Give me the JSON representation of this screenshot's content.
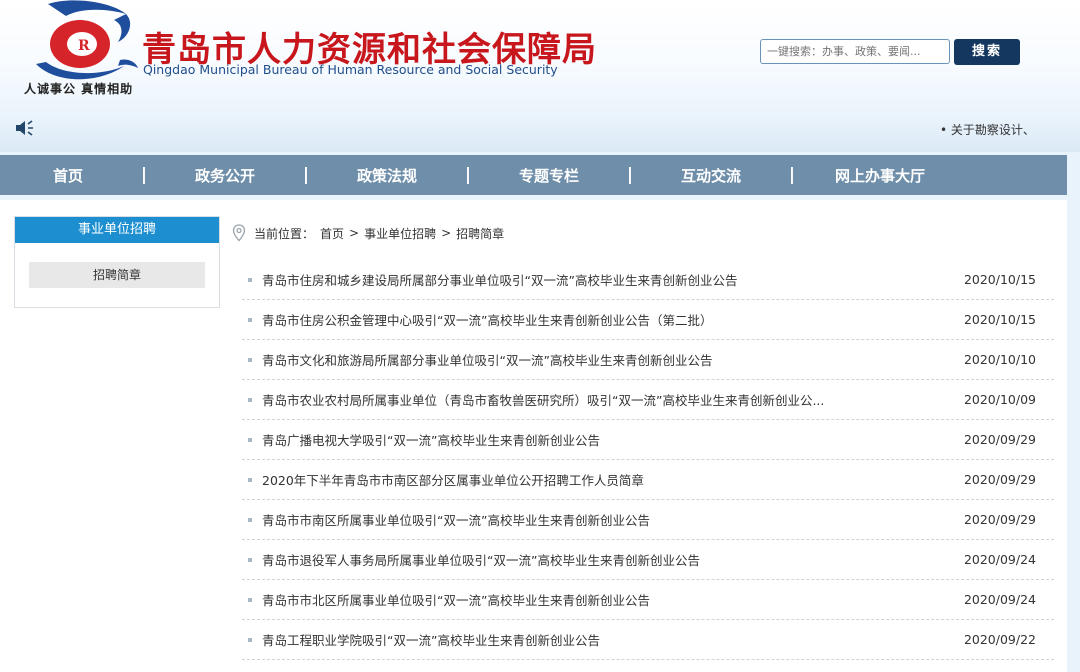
{
  "header": {
    "title_cn": "青岛市人力资源和社会保障局",
    "title_en": "Qingdao Municipal Bureau of Human Resource and Social Security",
    "slogan": "人诚事公  真情相助",
    "logo_icon": "bureau-logo-icon",
    "search": {
      "placeholder": "一键搜索：办事、政策、要闻...",
      "button_label": "搜索"
    }
  },
  "notice": {
    "icon": "speaker-icon",
    "text": "• 关于勘察设计、"
  },
  "nav": {
    "items": [
      {
        "label": "首页"
      },
      {
        "label": "政务公开"
      },
      {
        "label": "政策法规"
      },
      {
        "label": "专题专栏"
      },
      {
        "label": "互动交流"
      },
      {
        "label": "网上办事大厅"
      }
    ]
  },
  "sidebar": {
    "heading": "事业单位招聘",
    "items": [
      {
        "label": "招聘简章"
      }
    ]
  },
  "breadcrumb": {
    "icon": "location-pin-icon",
    "prefix": "当前位置：",
    "items": [
      "首页",
      "事业单位招聘",
      "招聘简章"
    ],
    "separator": ">"
  },
  "articles": [
    {
      "title": "青岛市住房和城乡建设局所属部分事业单位吸引“双一流”高校毕业生来青创新创业公告",
      "date": "2020/10/15"
    },
    {
      "title": "青岛市住房公积金管理中心吸引“双一流”高校毕业生来青创新创业公告（第二批）",
      "date": "2020/10/15"
    },
    {
      "title": "青岛市文化和旅游局所属部分事业单位吸引“双一流”高校毕业生来青创新创业公告",
      "date": "2020/10/10"
    },
    {
      "title": "青岛市农业农村局所属事业单位（青岛市畜牧兽医研究所）吸引“双一流”高校毕业生来青创新创业公...",
      "date": "2020/10/09"
    },
    {
      "title": "青岛广播电视大学吸引“双一流”高校毕业生来青创新创业公告",
      "date": "2020/09/29"
    },
    {
      "title": "2020年下半年青岛市市南区部分区属事业单位公开招聘工作人员简章",
      "date": "2020/09/29"
    },
    {
      "title": "青岛市市南区所属事业单位吸引“双一流”高校毕业生来青创新创业公告",
      "date": "2020/09/29"
    },
    {
      "title": "青岛市退役军人事务局所属事业单位吸引“双一流”高校毕业生来青创新创业公告",
      "date": "2020/09/24"
    },
    {
      "title": "青岛市市北区所属事业单位吸引“双一流”高校毕业生来青创新创业公告",
      "date": "2020/09/24"
    },
    {
      "title": "青岛工程职业学院吸引“双一流”高校毕业生来青创新创业公告",
      "date": "2020/09/22"
    }
  ],
  "colors": {
    "brand_red": "#c8161d",
    "nav_bg": "#6f8eaa",
    "accent_blue": "#1d8fd0",
    "search_btn": "#14375f"
  }
}
